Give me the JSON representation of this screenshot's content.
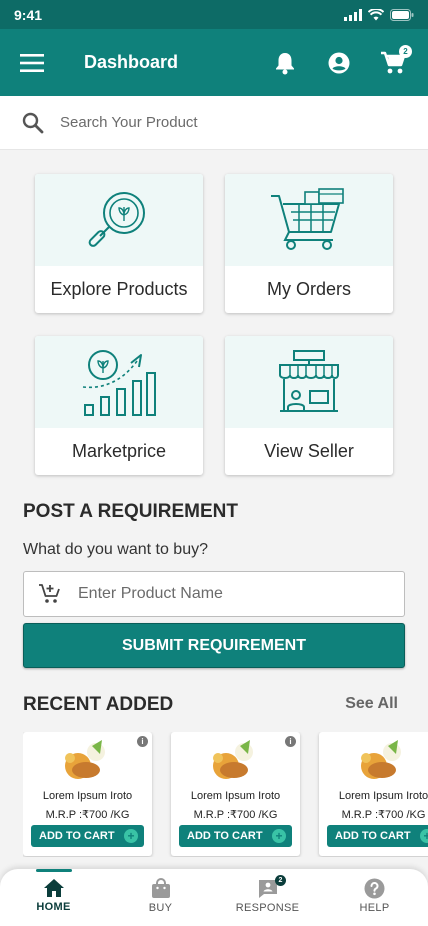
{
  "status_bar": {
    "time": "9:41"
  },
  "app_bar": {
    "title": "Dashboard",
    "cart_count": "2"
  },
  "search": {
    "placeholder": "Search Your Product"
  },
  "tiles": [
    {
      "label": "Explore Products"
    },
    {
      "label": "My Orders"
    },
    {
      "label": "Marketprice"
    },
    {
      "label": "View Seller"
    }
  ],
  "requirement": {
    "title": "POST A REQUIREMENT",
    "question": "What do you want to buy?",
    "input_placeholder": "Enter Product Name",
    "submit_label": "SUBMIT REQUIREMENT"
  },
  "recent": {
    "title": "RECENT ADDED",
    "see_all": "See All",
    "products": [
      {
        "name": "Lorem Ipsum Iroto",
        "price": "M.R.P :₹700 /KG",
        "button": "ADD TO CART"
      },
      {
        "name": "Lorem Ipsum Iroto",
        "price": "M.R.P :₹700 /KG",
        "button": "ADD TO CART"
      },
      {
        "name": "Lorem Ipsum Iroto",
        "price": "M.R.P :₹700 /KG",
        "button": "ADD TO CART"
      }
    ]
  },
  "bottom_nav": {
    "items": [
      {
        "label": "HOME",
        "icon": "home-icon",
        "active": true
      },
      {
        "label": "BUY",
        "icon": "shopping-bag-icon"
      },
      {
        "label": "RESPONSE",
        "icon": "response-icon",
        "badge": "2"
      },
      {
        "label": "HELP",
        "icon": "help-icon"
      }
    ]
  },
  "colors": {
    "primary": "#0f817b",
    "status_bar": "#0d6b66",
    "tile_bg": "#eef8f7"
  }
}
